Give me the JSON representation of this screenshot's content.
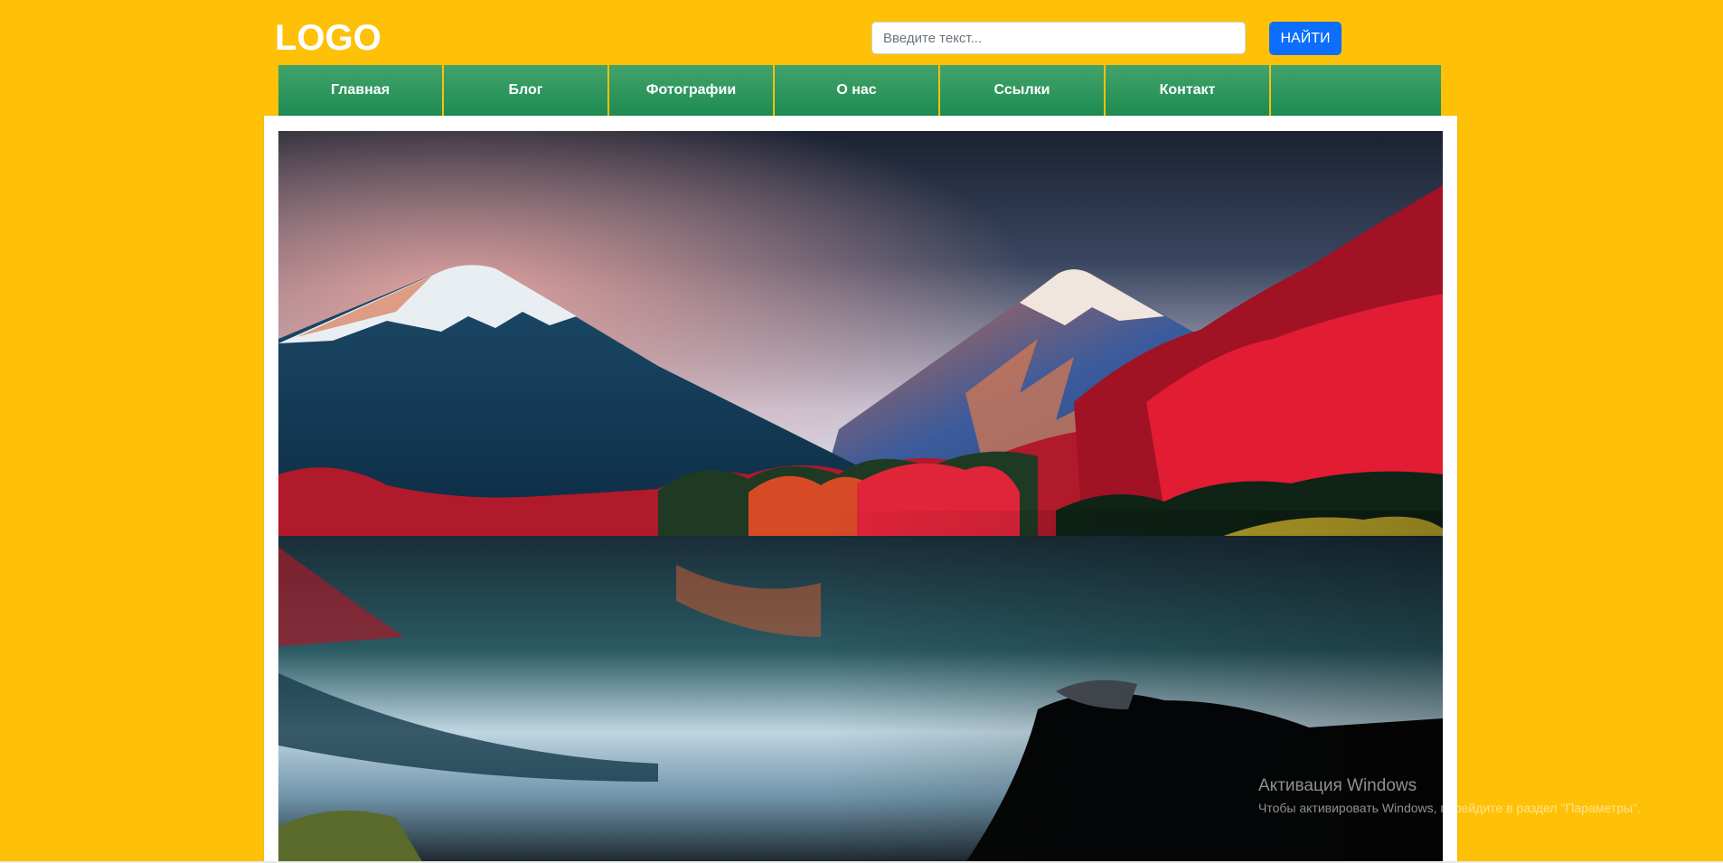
{
  "header": {
    "logo_text": "LOGO",
    "search_placeholder": "Введите текст...",
    "search_button_label": "НАЙТИ"
  },
  "nav": {
    "items": [
      {
        "label": "Главная"
      },
      {
        "label": "Блог"
      },
      {
        "label": "Фотографии"
      },
      {
        "label": "О нас"
      },
      {
        "label": "Ссылки"
      },
      {
        "label": "Контакт"
      }
    ]
  },
  "watermark": {
    "title": "Активация Windows",
    "subtitle": "Чтобы активировать Windows, перейдите в раздел \"Параметры\"."
  },
  "colors": {
    "background": "#ffc107",
    "nav_green": "#2a9a5e",
    "button_blue": "#0d6efd"
  }
}
